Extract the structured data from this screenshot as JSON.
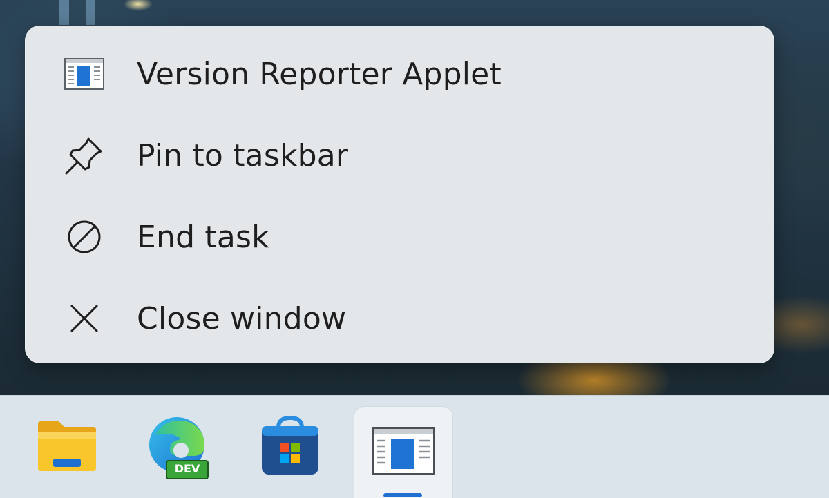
{
  "context_menu": {
    "items": [
      {
        "label": "Version Reporter Applet",
        "icon": "app-window-icon"
      },
      {
        "label": "Pin to taskbar",
        "icon": "pin-icon"
      },
      {
        "label": "End task",
        "icon": "prohibited-icon"
      },
      {
        "label": "Close window",
        "icon": "close-icon"
      }
    ]
  },
  "taskbar": {
    "apps": [
      {
        "name": "File Explorer",
        "icon": "folder-icon"
      },
      {
        "name": "Microsoft Edge Dev",
        "icon": "edge-dev-icon",
        "badge": "DEV"
      },
      {
        "name": "Microsoft Store",
        "icon": "store-icon"
      },
      {
        "name": "Version Reporter Applet",
        "icon": "app-window-icon",
        "active": true
      }
    ]
  },
  "colors": {
    "accent": "#1f6fd1",
    "menu_background": "#e4e7ea",
    "taskbar_background": "#dbe4ea",
    "edge_badge": "#3aa63a"
  }
}
